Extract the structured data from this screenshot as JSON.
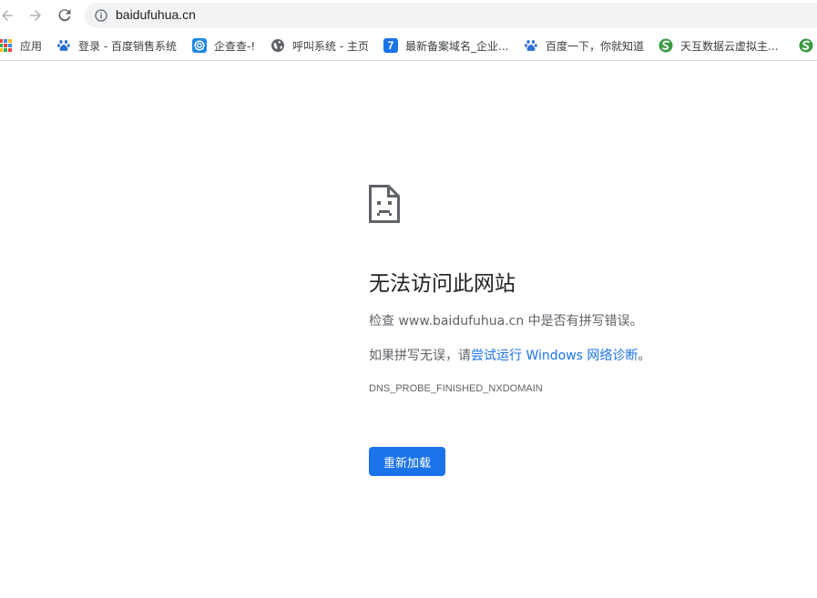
{
  "toolbar": {
    "url": "baidufuhua.cn"
  },
  "bookmarks": {
    "apps_label": "应用",
    "items": [
      {
        "label": "登录 - 百度销售系统",
        "icon": "baidu-paw-icon"
      },
      {
        "label": "企查查-!",
        "icon": "qichacha-icon"
      },
      {
        "label": "呼叫系统 - 主页",
        "icon": "globe-icon"
      },
      {
        "label": "最新备案域名_企业...",
        "icon": "seven-icon",
        "glyph": "7"
      },
      {
        "label": "百度一下，你就知道",
        "icon": "baidu-paw-icon"
      },
      {
        "label": "天互数据云虚拟主...",
        "icon": "tianhu-icon"
      },
      {
        "label": "",
        "icon": "tianhu-icon"
      }
    ]
  },
  "error": {
    "title": "无法访问此网站",
    "check_prefix": "检查 ",
    "domain": "www.baidufuhua.cn",
    "check_suffix": " 中是否有拼写错误。",
    "spell_prefix": "如果拼写无误，请",
    "diagnose_link": "尝试运行 Windows 网络诊断",
    "spell_suffix": "。",
    "error_code": "DNS_PROBE_FINISHED_NXDOMAIN",
    "reload_label": "重新加载"
  },
  "colors": {
    "accent": "#1a73e8",
    "text_secondary": "#5f6368",
    "omnibox_bg": "#f1f3f4"
  }
}
